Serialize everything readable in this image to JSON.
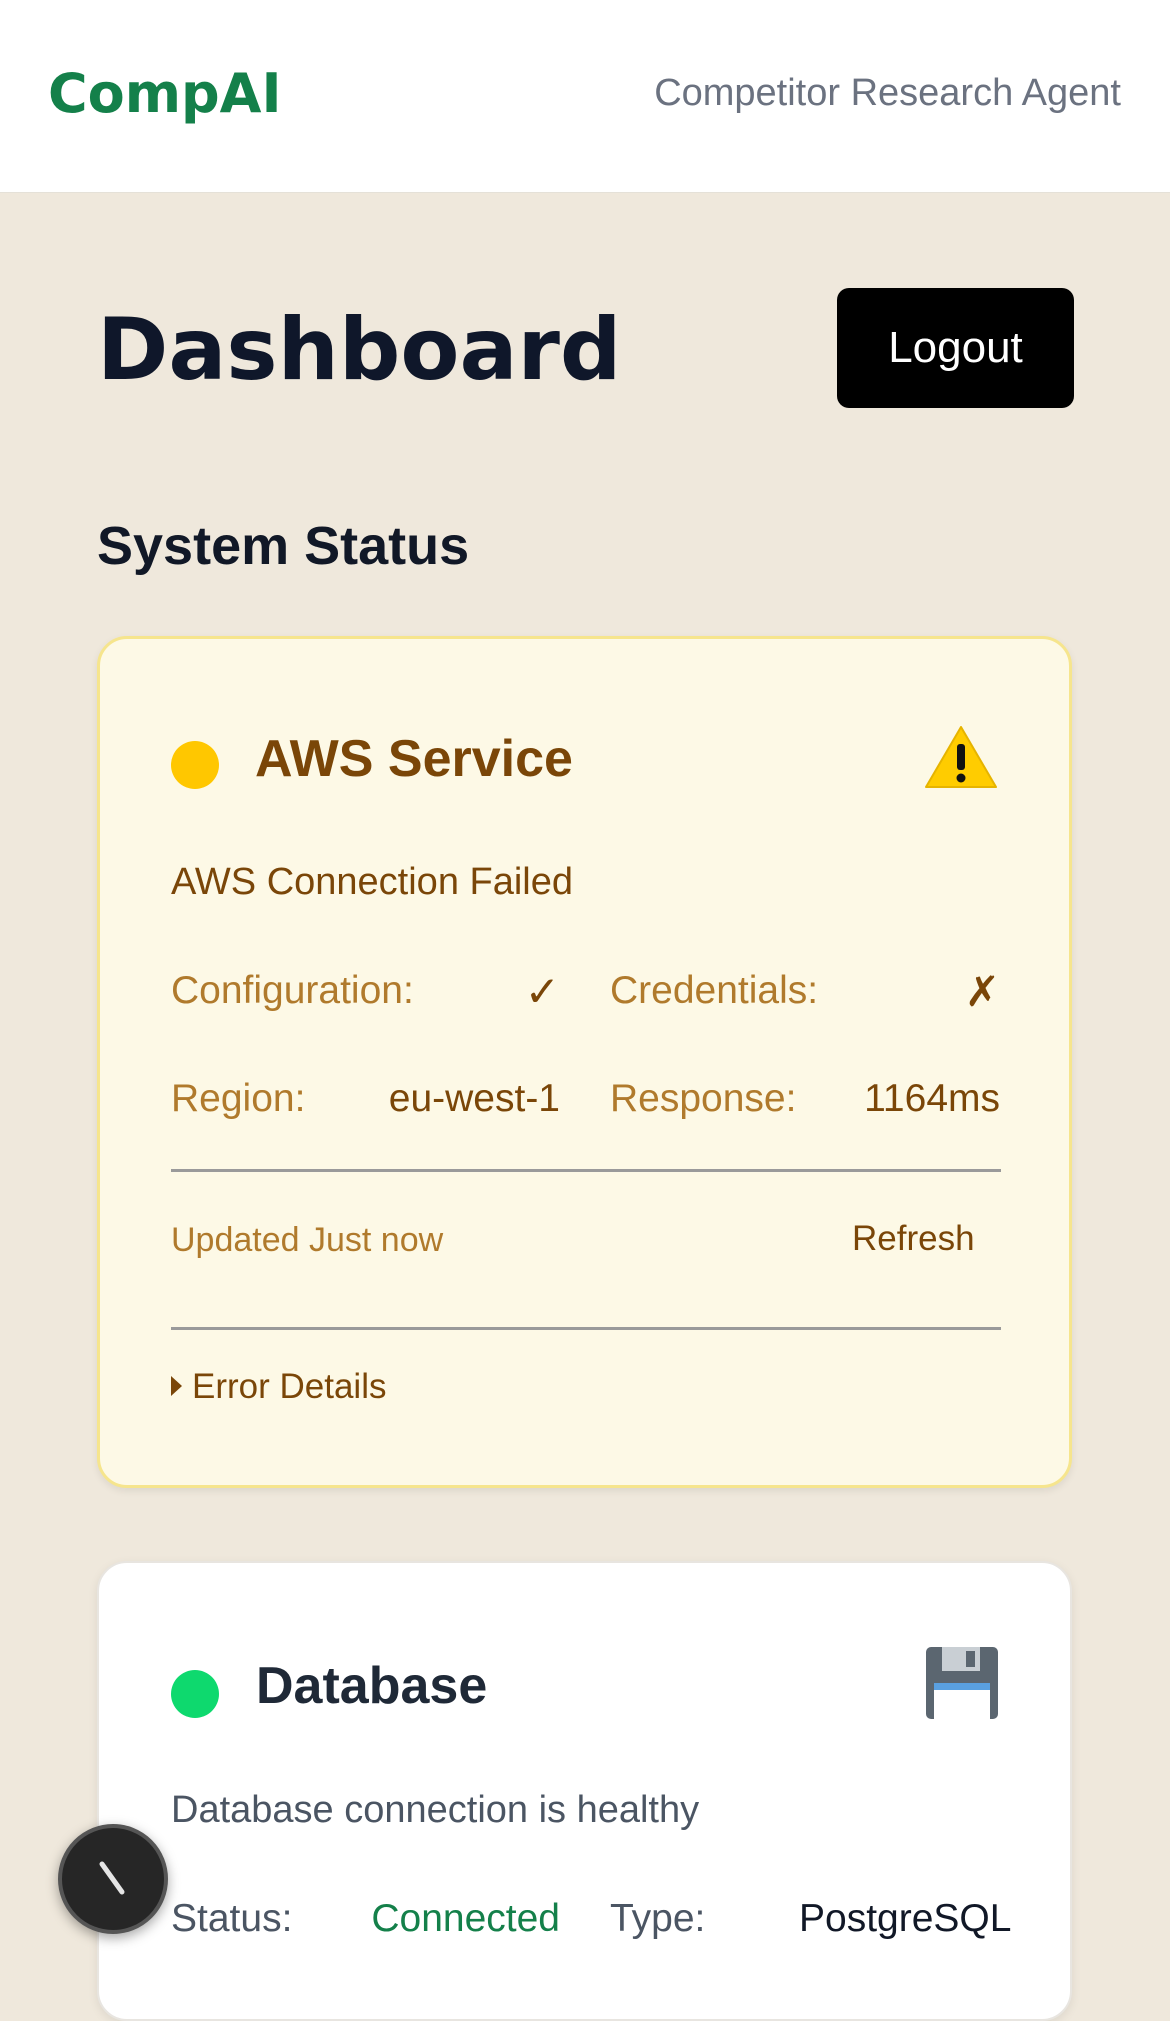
{
  "header": {
    "brand": "CompAI",
    "tagline": "Competitor Research Agent"
  },
  "page": {
    "title": "Dashboard",
    "logout_label": "Logout",
    "section_title": "System Status"
  },
  "aws_card": {
    "title": "AWS Service",
    "status_color": "#ffc700",
    "icon": "warning-icon",
    "message": "AWS Connection Failed",
    "configuration_label": "Configuration:",
    "configuration_value": "✓",
    "credentials_label": "Credentials:",
    "credentials_value": "✗",
    "region_label": "Region:",
    "region_value": "eu-west-1",
    "response_label": "Response:",
    "response_value": "1164ms",
    "updated_text": "Updated Just now",
    "refresh_label": "Refresh",
    "error_details_label": "Error Details"
  },
  "db_card": {
    "title": "Database",
    "status_color": "#0ed96e",
    "icon": "floppy-disk-icon",
    "message": "Database connection is healthy",
    "status_label": "Status:",
    "status_value": "Connected",
    "type_label": "Type:",
    "type_value": "PostgreSQL"
  },
  "colors": {
    "brand": "#14804a",
    "page_bg": "#efe8dc",
    "warning_card_bg": "#fdf9e6",
    "warning_text": "#7a4608",
    "connected_text": "#14804a"
  }
}
